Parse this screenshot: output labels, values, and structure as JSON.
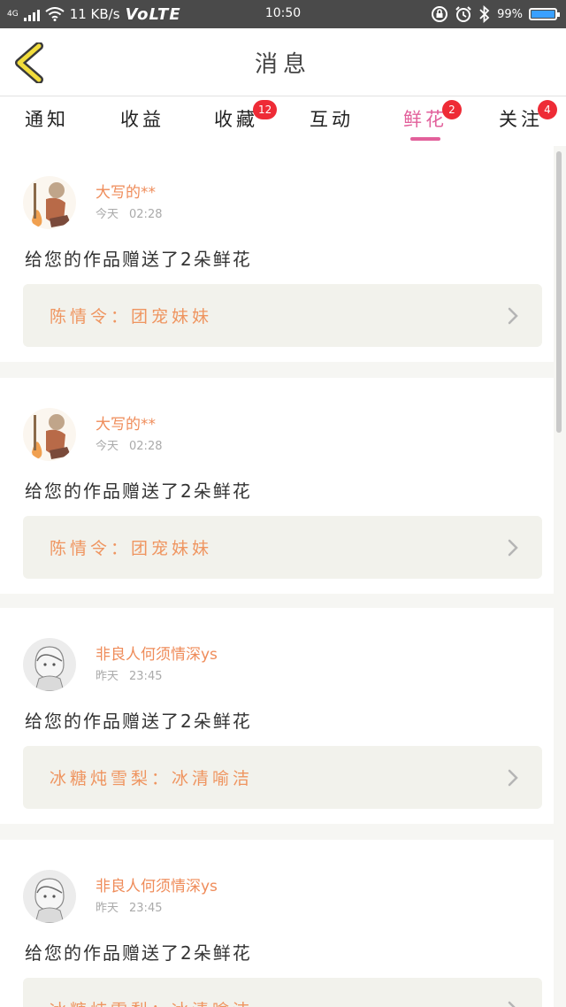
{
  "status_bar": {
    "network": "4G",
    "speed": "11 KB/s",
    "volte": "VoLTE",
    "time": "10:50",
    "battery": "99%",
    "battery_level": 0.99
  },
  "header": {
    "title": "消息"
  },
  "tabs": [
    {
      "label": "通知",
      "badge": "",
      "active": false
    },
    {
      "label": "收益",
      "badge": "",
      "active": false
    },
    {
      "label": "收藏",
      "badge": "12",
      "active": false
    },
    {
      "label": "互动",
      "badge": "",
      "active": false
    },
    {
      "label": "鲜花",
      "badge": "2",
      "active": true
    },
    {
      "label": "关注",
      "badge": "4",
      "active": false
    }
  ],
  "colors": {
    "accent": "#e2609b",
    "username": "#ef8c5a",
    "badge": "#ee2b36",
    "ref_bg": "#f2f2ec"
  },
  "messages": [
    {
      "user": "大写的**",
      "date": "今天",
      "time": "02:28",
      "text": "给您的作品赠送了2朵鲜花",
      "work": "陈情令：团宠妹妹",
      "avatar": "character-avatar"
    },
    {
      "user": "大写的**",
      "date": "今天",
      "time": "02:28",
      "text": "给您的作品赠送了2朵鲜花",
      "work": "陈情令：团宠妹妹",
      "avatar": "character-avatar"
    },
    {
      "user": "非良人何须情深ys",
      "date": "昨天",
      "time": "23:45",
      "text": "给您的作品赠送了2朵鲜花",
      "work": "冰糖炖雪梨：冰清喻洁",
      "avatar": "sketch-avatar"
    },
    {
      "user": "非良人何须情深ys",
      "date": "昨天",
      "time": "23:45",
      "text": "给您的作品赠送了2朵鲜花",
      "work": "冰糖炖雪梨：冰清喻洁",
      "avatar": "sketch-avatar"
    }
  ]
}
